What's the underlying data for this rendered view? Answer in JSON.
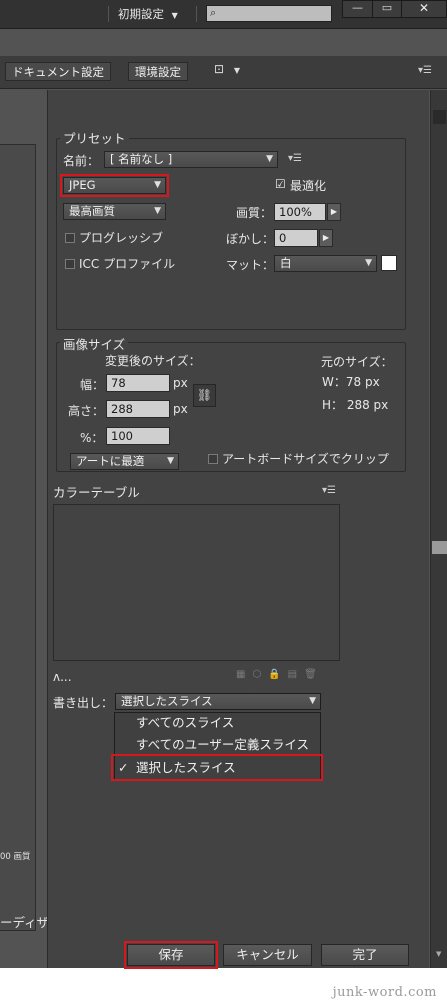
{
  "topbar": {
    "workspace_label": "初期設定",
    "search_placeholder": ""
  },
  "window_controls": {
    "minimize": "—",
    "restore": "▭",
    "close": "✕"
  },
  "toolbar": {
    "document_settings": "ドキュメント設定",
    "preferences": "環境設定"
  },
  "preset": {
    "title": "プリセット",
    "name_label": "名前：",
    "name_value": "[ 名前なし ]",
    "format_value": "JPEG",
    "optimize_label": "最適化",
    "quality_select": "最高画質",
    "quality_label": "画質：",
    "quality_value": "100%",
    "progressive_label": "プログレッシブ",
    "blur_label": "ぼかし：",
    "blur_value": "0",
    "icc_label": "ICC プロファイル",
    "matte_label": "マット：",
    "matte_value": "白"
  },
  "image_size": {
    "title": "画像サイズ",
    "new_size_label": "変更後のサイズ：",
    "width_label": "幅：",
    "width_value": "78",
    "height_label": "高さ：",
    "height_value": "288",
    "percent_label": "%：",
    "percent_value": "100",
    "unit": "px",
    "original_label": "元のサイズ：",
    "original_w": "W：78 px",
    "original_h": "H： 288 px",
    "fit_select": "アートに最適",
    "clip_label": "アートボードサイズでクリップ"
  },
  "color_table": {
    "title": "カラーテーブル",
    "count_label": "ʌ..."
  },
  "export": {
    "label": "書き出し：",
    "value": "選択したスライス",
    "options": [
      "すべてのスライス",
      "すべてのユーザー定義スライス",
      "選択したスライス"
    ],
    "selected_mark": "✓"
  },
  "preview": {
    "pixel_text": "00 画質",
    "partial_label": "ーディザ"
  },
  "buttons": {
    "save": "保存",
    "cancel": "キャンセル",
    "done": "完了"
  },
  "watermark": "junk-word.com",
  "colors": {
    "highlight": "#d8161d",
    "panel": "#434343",
    "matte_swatch": "#ffffff"
  }
}
